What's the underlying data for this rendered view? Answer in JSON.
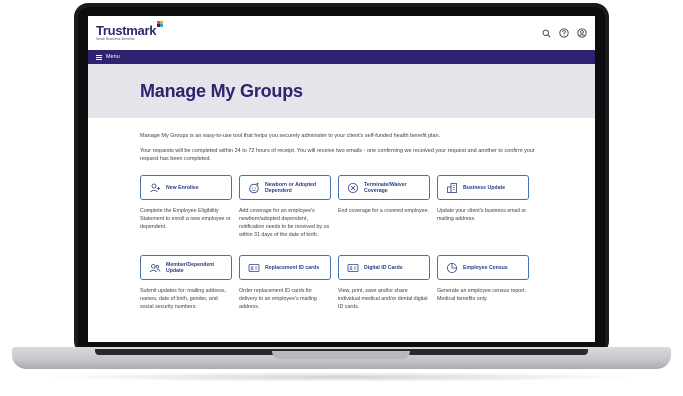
{
  "header": {
    "brand": "Trustmark",
    "brand_sub": "Small Business Benefits",
    "icons": [
      "search-icon",
      "help-icon",
      "user-icon"
    ]
  },
  "menubar": {
    "label": "Menu"
  },
  "hero": {
    "title": "Manage My Groups"
  },
  "intro": {
    "p1": "Manage My Groups is an easy-to-use tool that helps you securely administer to your client's self-funded health benefit plan.",
    "p2": "Your requests will be completed within 24 to 72 hours of receipt. You will receive two emails - one confirming we received your request and another to confirm your request has been completed."
  },
  "cards": [
    {
      "label": "New Enrollee",
      "icon": "add-person-icon",
      "desc": "Complete the Employee Eligibility Statement to enroll a new employee or dependent."
    },
    {
      "label": "Newborn or Adopted Dependent",
      "icon": "baby-icon",
      "desc": "Add coverage for an employee's newborn/adopted dependent, notification needs to be received by us within 31 days of the date of birth."
    },
    {
      "label": "Terminate/Waiver Coverage",
      "icon": "cancel-icon",
      "desc": "End coverage for a covered employee."
    },
    {
      "label": "Business Update",
      "icon": "building-icon",
      "desc": "Update your client's business email or mailing address."
    },
    {
      "label": "Member/Dependent Update",
      "icon": "people-icon",
      "desc": "Submit updates for: mailing address, names, date of birth, gender, and social security numbers."
    },
    {
      "label": "Replacement ID cards",
      "icon": "id-card-icon",
      "desc": "Order replacement ID cards for delivery to an employee's mailing address."
    },
    {
      "label": "Digital ID Cards",
      "icon": "id-card-icon",
      "desc": "View, print, save and/or share individual medical and/or dental digital ID cards."
    },
    {
      "label": "Employee Census",
      "icon": "pie-chart-icon",
      "desc": "Generate an employee census report. Medical benefits only."
    }
  ],
  "colors": {
    "brand_navy": "#2d2371",
    "accent_blue": "#4a6fb3",
    "hero_bg": "#e4e5ea"
  }
}
